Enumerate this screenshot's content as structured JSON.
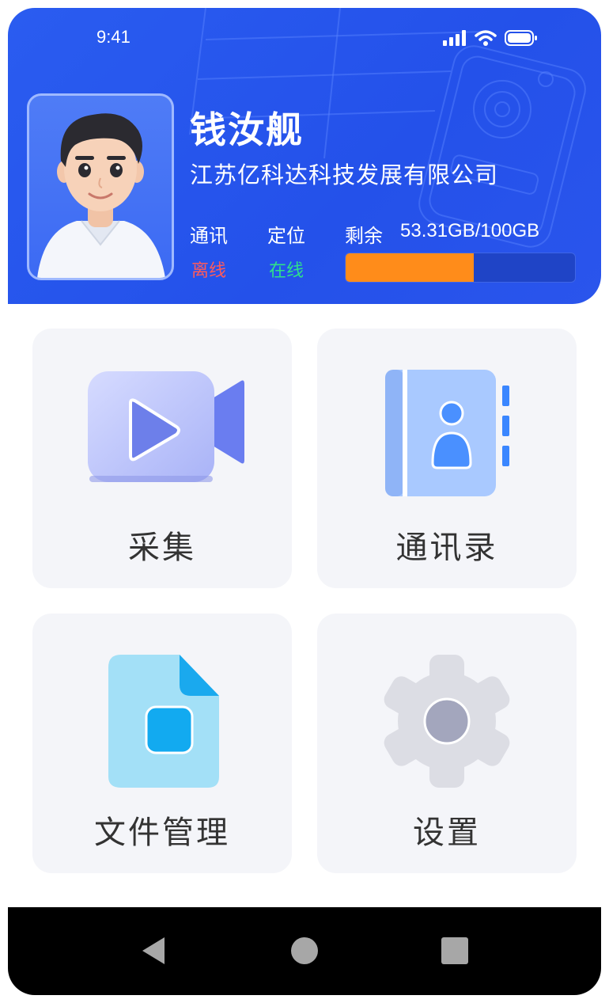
{
  "status_bar": {
    "time": "9:41",
    "icons": [
      "signal-icon",
      "wifi-icon",
      "battery-icon"
    ]
  },
  "profile": {
    "name": "钱汝舰",
    "company": "江苏亿科达科技发展有限公司",
    "communication": {
      "label": "通讯",
      "status": "离线",
      "color": "#ff5b5b"
    },
    "location": {
      "label": "定位",
      "status": "在线",
      "color": "#2fe08a"
    },
    "storage": {
      "label": "剩余",
      "value": "53.31GB/100GB",
      "used_fraction": 0.56,
      "fill_color": "#ff8c1a"
    }
  },
  "menu": [
    {
      "label": "采集",
      "icon": "video-camera-icon"
    },
    {
      "label": "通讯录",
      "icon": "contacts-book-icon"
    },
    {
      "label": "文件管理",
      "icon": "file-icon"
    },
    {
      "label": "设置",
      "icon": "gear-icon"
    }
  ],
  "nav": {
    "icons": [
      "back-icon",
      "home-icon",
      "recents-icon"
    ]
  },
  "colors": {
    "header_blue": "#2a5cf0",
    "tile_bg": "#f4f5f9"
  }
}
